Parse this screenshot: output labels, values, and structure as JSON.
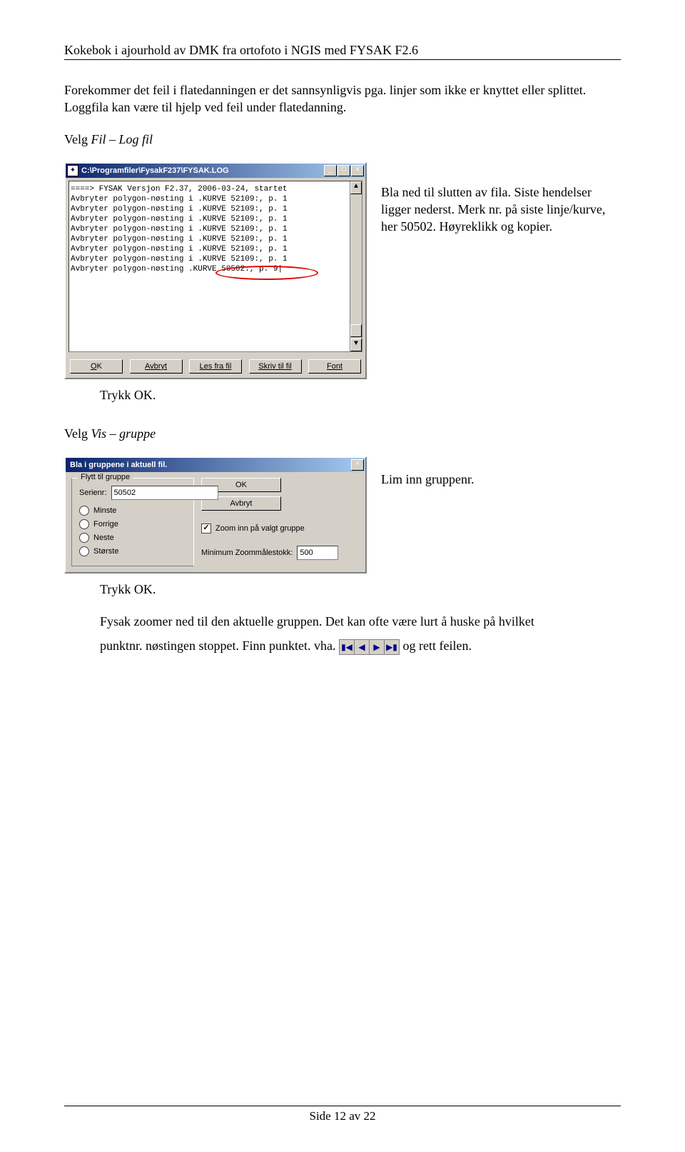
{
  "header": "Kokebok i ajourhold av DMK fra ortofoto i NGIS med FYSAK F2.6",
  "para1": "Forekommer det feil i flatedanningen er det sannsynligvis pga. linjer som ikke er knyttet eller splittet. Loggfila kan være til hjelp ved feil under flatedanning.",
  "velg1_pre": "Velg ",
  "velg1_it": "Fil – Log fil",
  "log": {
    "title": "C:\\Programfiler\\FysakF237\\FYSAK.LOG",
    "lines": [
      "====> FYSAK Versjon F2.37,   2006-03-24,   startet",
      " ",
      "Avbryter polygon-nøsting i .KURVE 52109:, p. 1",
      "Avbryter polygon-nøsting i .KURVE 52109:, p. 1",
      "Avbryter polygon-nøsting i .KURVE 52109:, p. 1",
      "Avbryter polygon-nøsting i .KURVE 52109:, p. 1",
      "Avbryter polygon-nøsting i .KURVE 52109:, p. 1",
      "Avbryter polygon-nøsting i .KURVE 52109:, p. 1",
      "Avbryter polygon-nøsting i .KURVE 52109:, p. 1",
      "Avbryter polygon-nøsting  .KURVE 50502:, p. 9|"
    ],
    "buttons": {
      "ok": "OK",
      "avbryt": "Avbryt",
      "lesfrafil": "Les fra fil",
      "skrivtilfil": "Skriv til fil",
      "font": "Font"
    }
  },
  "side_text_log": "Bla ned til slutten av fila. Siste hendelser ligger nederst. Merk nr. på siste linje/kurve, her 50502. Høyreklikk og kopier.",
  "trykk_ok": "Trykk OK.",
  "velg2_pre": "Velg ",
  "velg2_it": "Vis – gruppe",
  "dlg": {
    "title": "Bla i gruppene i aktuell fil.",
    "group_legend": "Flytt til gruppe",
    "serienr_label": "Serienr:",
    "serienr_value": "50502",
    "radios": [
      "Minste",
      "Forrige",
      "Neste",
      "Største"
    ],
    "ok": "OK",
    "avbryt": "Avbryt",
    "zoom_check": "Zoom inn på valgt gruppe",
    "min_label": "Minimum Zoommålestokk:",
    "min_value": "500"
  },
  "side_text_dlg": "Lim inn gruppenr.",
  "final1": "Fysak zoomer ned til den aktuelle gruppen. Det kan ofte være lurt å huske på hvilket",
  "final2a": "punktnr. nøstingen stoppet. Finn punktet. vha. ",
  "final2b": " og rett feilen.",
  "footer": "Side 12 av 22"
}
